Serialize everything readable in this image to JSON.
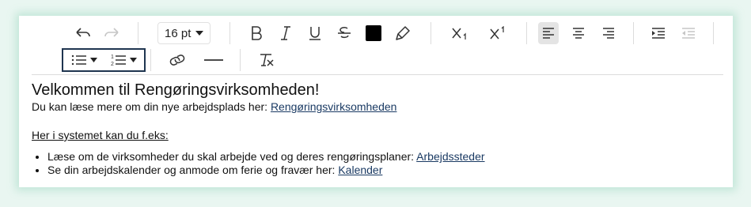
{
  "toolbar": {
    "font_size": "16 pt",
    "icons": {
      "undo": "undo-icon",
      "redo": "redo-icon",
      "bold": "bold-icon",
      "italic": "italic-icon",
      "underline": "underline-icon",
      "strikethrough": "strikethrough-icon",
      "text_color": "text-color-swatch",
      "highlight": "highlight-icon",
      "subscript": "subscript-icon",
      "superscript": "superscript-icon",
      "align_left": "align-left-icon",
      "align_center": "align-center-icon",
      "align_right": "align-right-icon",
      "indent": "indent-icon",
      "outdent": "outdent-icon",
      "bullet_list": "bullet-list-icon",
      "numbered_list": "numbered-list-icon",
      "link": "link-icon",
      "horizontal_rule": "horizontal-rule-icon",
      "clear_format": "clear-format-icon"
    },
    "text_color_value": "#000000",
    "list_group_border": "#1f3550"
  },
  "content": {
    "heading": "Velkommen til Rengøringsvirksomheden!",
    "intro_text": "Du kan læse mere om din nye arbejdsplads her: ",
    "intro_link": "Rengøringsvirksomheden",
    "section_title": "Her i systemet kan du f.eks:",
    "bullets": [
      {
        "text": "Læse om de virksomheder du skal arbejde ved og deres rengøringsplaner: ",
        "link": "Arbejdssteder "
      },
      {
        "text": "Se din arbejdskalender og anmode om ferie og fravær her: ",
        "link": "Kalender"
      }
    ]
  }
}
